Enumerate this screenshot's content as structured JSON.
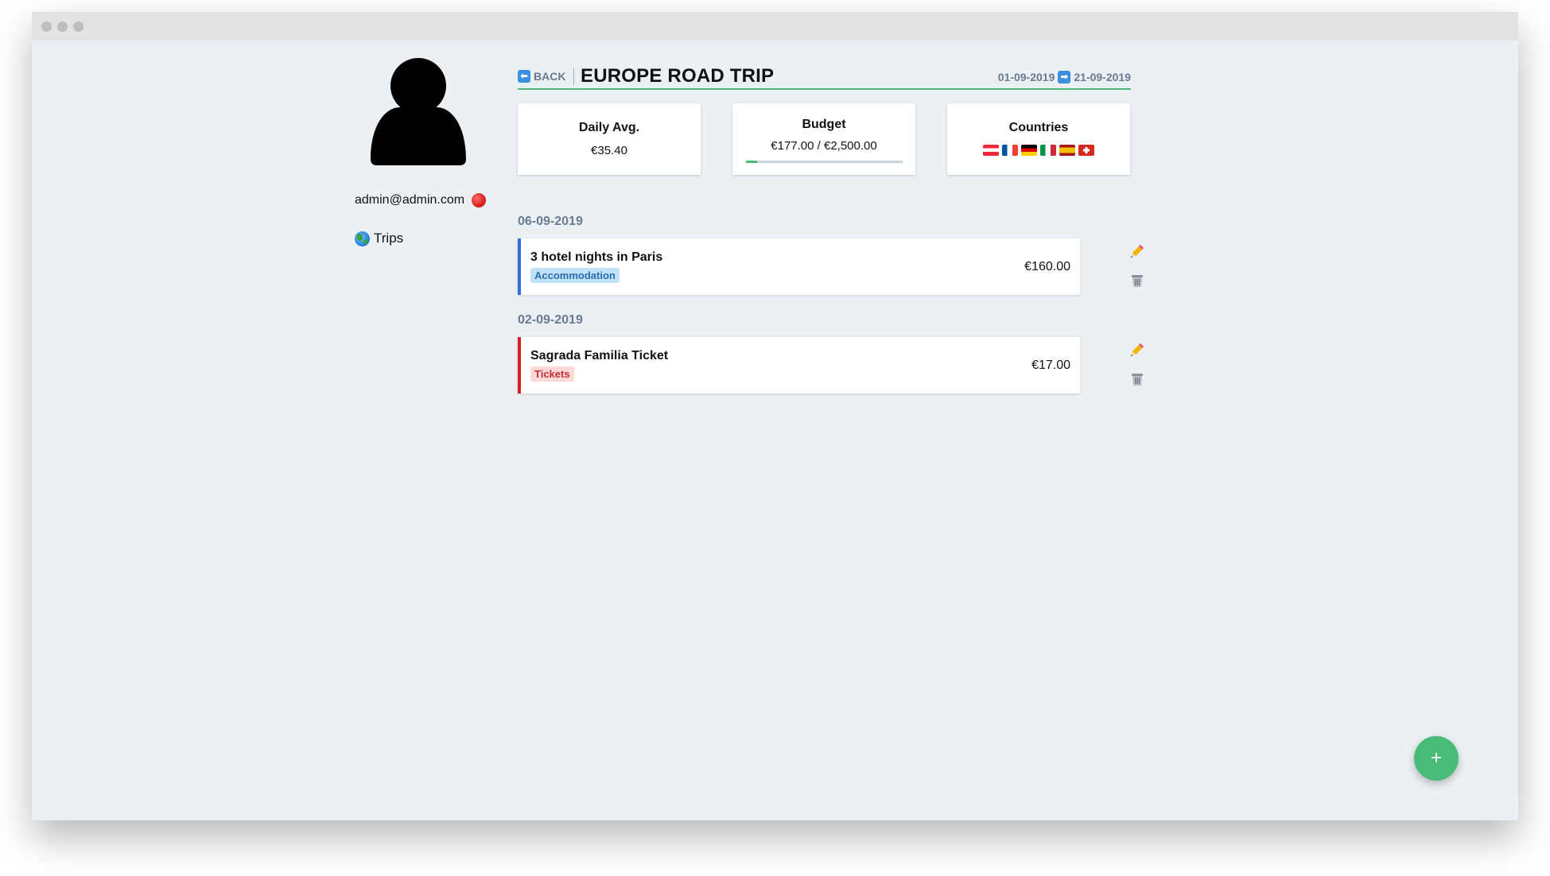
{
  "user": {
    "email": "admin@admin.com"
  },
  "nav": {
    "trips_label": "Trips"
  },
  "header": {
    "back_label": "BACK",
    "trip_title": "EUROPE ROAD TRIP",
    "start_date": "01-09-2019",
    "end_date": "21-09-2019"
  },
  "stats": {
    "daily_avg_label": "Daily Avg.",
    "daily_avg_value": "€35.40",
    "budget_label": "Budget",
    "budget_value": "€177.00 / €2,500.00",
    "budget_progress_fraction": 0.0708,
    "countries_label": "Countries",
    "countries": [
      "Austria",
      "France",
      "Germany",
      "Italy",
      "Spain",
      "Switzerland"
    ]
  },
  "expense_groups": [
    {
      "date": "06-09-2019",
      "items": [
        {
          "name": "3 hotel nights in Paris",
          "category": "Accommodation",
          "amount": "€160.00",
          "accent_color": "#2f6fdb"
        }
      ]
    },
    {
      "date": "02-09-2019",
      "items": [
        {
          "name": "Sagrada Familia Ticket",
          "category": "Tickets",
          "amount": "€17.00",
          "accent_color": "#d61f1f"
        }
      ]
    }
  ],
  "fab": {
    "label": "+"
  },
  "colors": {
    "accent": "#48bb78",
    "muted": "#6b7a8f",
    "background": "#ebf0f5"
  },
  "icons": [
    "avatar-icon",
    "status-dot-icon",
    "globe-icon",
    "back-arrow-icon",
    "right-arrow-icon",
    "pencil-icon",
    "trash-icon"
  ]
}
